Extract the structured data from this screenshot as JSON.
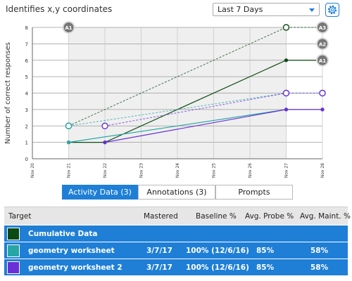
{
  "header": {
    "title": "Identifies x,y coordinates"
  },
  "range_select": {
    "value": "Last 7 Days"
  },
  "icons": {
    "settings": "gear-icon",
    "dropdown": "chevron-down-icon"
  },
  "colors": {
    "accent": "#1f7fd6",
    "cumulative": "#0b4a12",
    "geometry_worksheet": "#27a6a6",
    "geometry_worksheet_2": "#6a2fd8",
    "marker_gray": "#777777"
  },
  "chart_data": {
    "type": "line",
    "ylabel": "Number of correct responses",
    "xlabel": "",
    "ylim": [
      0,
      8
    ],
    "y_ticks": [
      "0",
      "1",
      "2",
      "3",
      "4",
      "5",
      "6",
      "7",
      "8"
    ],
    "categories": [
      "Nov 20",
      "Nov 21",
      "Nov 22",
      "Nov 23",
      "Nov 24",
      "Nov 25",
      "Nov 26",
      "Nov 27",
      "Nov 28"
    ],
    "shaded_range": [
      "Nov 21",
      "Nov 27"
    ],
    "series": [
      {
        "name": "Cumulative Data",
        "color": "#0b4a12",
        "solid": [
          [
            "Nov 21",
            1
          ],
          [
            "Nov 22",
            1
          ],
          [
            "Nov 27",
            6
          ],
          [
            "Nov 28",
            6
          ]
        ],
        "dashed": [
          [
            "Nov 21",
            2
          ],
          [
            "Nov 27",
            8
          ],
          [
            "Nov 28",
            8
          ]
        ]
      },
      {
        "name": "geometry worksheet",
        "color": "#27a6a6",
        "solid": [
          [
            "Nov 21",
            1
          ],
          [
            "Nov 27",
            3
          ],
          [
            "Nov 28",
            3
          ]
        ],
        "dashed": [
          [
            "Nov 21",
            2
          ],
          [
            "Nov 27",
            4
          ],
          [
            "Nov 28",
            4
          ]
        ]
      },
      {
        "name": "geometry worksheet 2",
        "color": "#6a2fd8",
        "solid": [
          [
            "Nov 22",
            1
          ],
          [
            "Nov 27",
            3
          ],
          [
            "Nov 28",
            3
          ]
        ],
        "dashed": [
          [
            "Nov 22",
            2
          ],
          [
            "Nov 27",
            4
          ],
          [
            "Nov 28",
            4
          ]
        ]
      }
    ],
    "annotations": [
      {
        "label": "A1",
        "x": "Nov 21",
        "y": 8
      },
      {
        "label": "A3",
        "x": "Nov 28",
        "y": 8
      },
      {
        "label": "A2",
        "x": "Nov 28",
        "y": 7
      },
      {
        "label": "A1",
        "x": "Nov 28",
        "y": 6
      }
    ]
  },
  "tabs": [
    {
      "label": "Activity Data (3)",
      "active": true
    },
    {
      "label": "Annotations (3)",
      "active": false
    },
    {
      "label": "Prompts",
      "active": false
    }
  ],
  "table": {
    "headers": [
      "Target",
      "Mastered",
      "Baseline %",
      "Avg. Probe %",
      "Avg. Maint. %"
    ],
    "rows": [
      {
        "color": "#0b4a12",
        "target": "Cumulative Data",
        "mastered": "",
        "baseline": "",
        "probe": "",
        "maint": ""
      },
      {
        "color": "#27a6a6",
        "target": "geometry worksheet",
        "mastered": "3/7/17",
        "baseline": "100% (12/6/16)",
        "probe": "85%",
        "maint": "58%"
      },
      {
        "color": "#6a2fd8",
        "target": "geometry worksheet 2",
        "mastered": "3/7/17",
        "baseline": "100% (12/6/16)",
        "probe": "85%",
        "maint": "58%"
      }
    ]
  }
}
